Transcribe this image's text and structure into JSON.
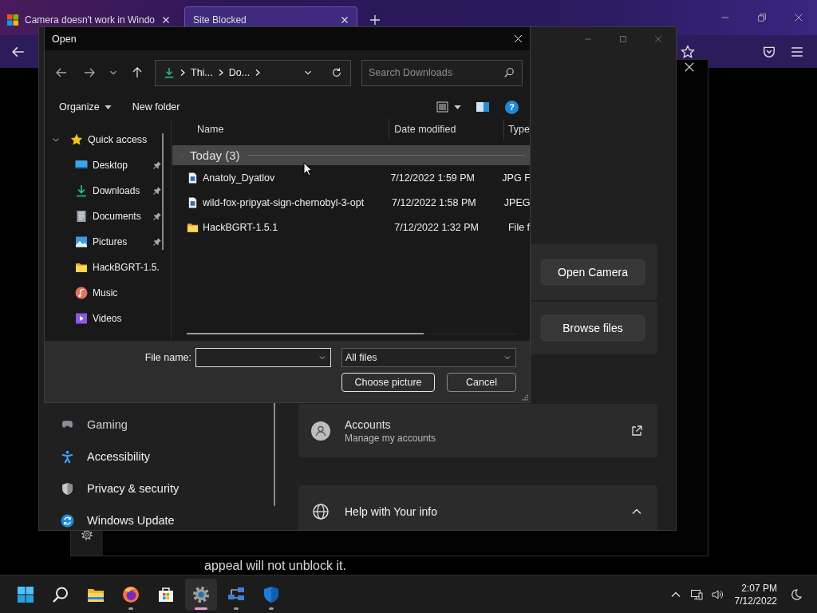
{
  "browser": {
    "tabs": [
      {
        "title": "Camera doesn't work in Windo",
        "selected": false,
        "kind": "page"
      },
      {
        "title": "Site Blocked",
        "selected": true,
        "kind": "blocked"
      }
    ]
  },
  "page": {
    "notice": "appeal will not unblock it."
  },
  "settings": {
    "nav": [
      {
        "label": "Gaming",
        "kind": "gaming"
      },
      {
        "label": "Accessibility",
        "kind": "accessibility"
      },
      {
        "label": "Privacy & security",
        "kind": "privacy"
      },
      {
        "label": "Windows Update",
        "kind": "update"
      }
    ],
    "camera_button": "Open Camera",
    "browse_button": "Browse files",
    "accounts": {
      "title": "Accounts",
      "subtitle": "Manage my accounts"
    },
    "help": {
      "title": "Help with Your info",
      "expanded": true
    }
  },
  "dialog": {
    "title": "Open",
    "path": [
      "Thi...",
      "Do..."
    ],
    "search_placeholder": "Search Downloads",
    "organize": "Organize",
    "new_folder": "New folder",
    "help_glyph": "?",
    "nav": [
      {
        "label": "Quick access",
        "kind": "star",
        "expanded": true,
        "children": [
          {
            "label": "Desktop",
            "kind": "desktop",
            "pinned": true
          },
          {
            "label": "Downloads",
            "kind": "downloads",
            "pinned": true
          },
          {
            "label": "Documents",
            "kind": "documents",
            "pinned": true
          },
          {
            "label": "Pictures",
            "kind": "pictures",
            "pinned": true
          },
          {
            "label": "HackBGRT-1.5.",
            "kind": "folder",
            "pinned": false
          },
          {
            "label": "Music",
            "kind": "music",
            "pinned": false
          },
          {
            "label": "Videos",
            "kind": "videos",
            "pinned": false
          }
        ]
      }
    ],
    "columns": [
      "Name",
      "Date modified",
      "Type"
    ],
    "group": {
      "label": "Today (3)",
      "expanded": true
    },
    "files": [
      {
        "name": "Anatoly_Dyatlov",
        "date": "7/12/2022 1:59 PM",
        "type": "JPG F",
        "kind": "image"
      },
      {
        "name": "wild-fox-pripyat-sign-chernobyl-3-opt",
        "date": "7/12/2022 1:58 PM",
        "type": "JPEG",
        "kind": "image"
      },
      {
        "name": "HackBGRT-1.5.1",
        "date": "7/12/2022 1:32 PM",
        "type": "File f",
        "kind": "folder"
      }
    ],
    "file_name_label": "File name:",
    "file_type": "All files",
    "ok_button": "Choose picture",
    "cancel_button": "Cancel"
  },
  "taskbar": {
    "apps": [
      {
        "kind": "start",
        "running": false,
        "selected": false
      },
      {
        "kind": "search",
        "running": false,
        "selected": false
      },
      {
        "kind": "explorer",
        "running": false,
        "selected": false
      },
      {
        "kind": "firefox",
        "running": true,
        "selected": false
      },
      {
        "kind": "store",
        "running": false,
        "selected": false
      },
      {
        "kind": "settings",
        "running": true,
        "selected": true
      },
      {
        "kind": "network",
        "running": true,
        "selected": false
      },
      {
        "kind": "defender",
        "running": true,
        "selected": false
      }
    ],
    "time": "2:07 PM",
    "date": "7/12/2022"
  }
}
